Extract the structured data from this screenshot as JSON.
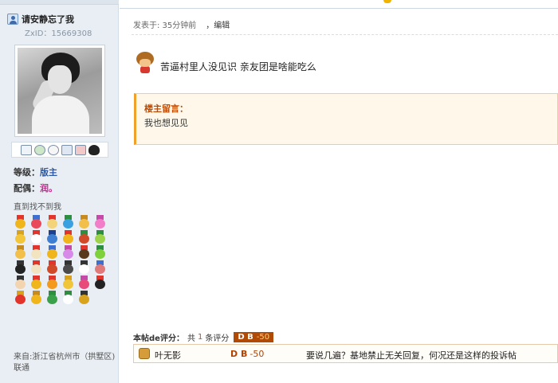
{
  "user": {
    "name": "请安静忘了我",
    "zxid": "ZxID：15669308",
    "level_label": "等级：",
    "level_value": "版主",
    "spouse_label": "配偶：",
    "spouse_value": "润。",
    "signature": "直到找不到我",
    "location": "来自:浙江省杭州市（拱墅区)联通"
  },
  "post": {
    "posted_at": "发表于: 35分钟前",
    "edit_label": "，编辑",
    "content": "苦逼村里人没见识  亲友团是啥能吃么",
    "note_title": "楼主留言：",
    "note_body": "我也想见见"
  },
  "rating": {
    "title": "本帖de评分：",
    "prefix": "共",
    "count": "1",
    "suffix": "条评分",
    "badge_key": "D B",
    "badge_value": "-50",
    "entries": [
      {
        "user": "叶无影",
        "key": "D B",
        "value": "-50",
        "reason": "要说几遍？基地禁止无关回复，何况还是这样的投诉帖"
      }
    ]
  },
  "colors": {
    "accent_orange": "#f0a12c",
    "note_bg": "#fff8ea",
    "badge": "#b04a06",
    "left_bg": "#e9eef4"
  },
  "icons": [
    "user-icon",
    "mail-icon",
    "add-friend-icon",
    "search-icon",
    "profile-card-icon",
    "group-icon",
    "qq-icon",
    "monkey-emoticon-icon",
    "rater-avatar-icon"
  ]
}
